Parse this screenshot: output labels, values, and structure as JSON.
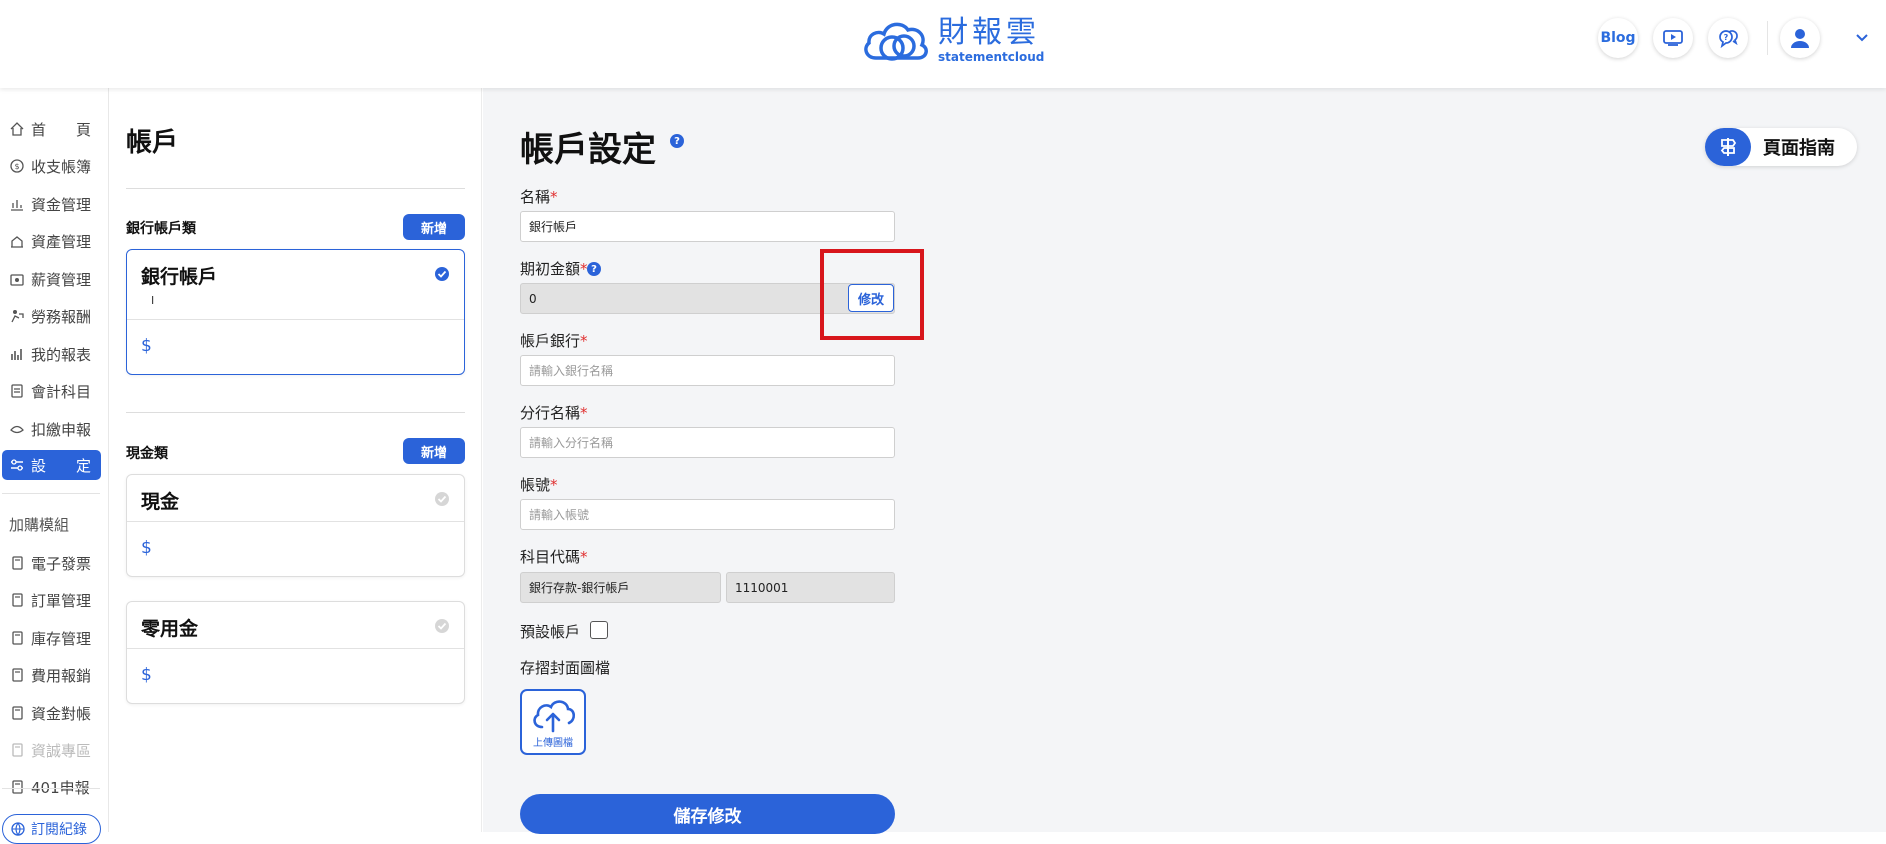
{
  "header": {
    "logo_text": "財報雲",
    "logo_sub": "statementcloud",
    "blog_label": "Blog",
    "icons": [
      "video-guide-icon",
      "support-chat-icon",
      "user-icon",
      "chevron-down-icon"
    ]
  },
  "nav": {
    "items": [
      {
        "label": "首　　頁",
        "icon": "home-icon"
      },
      {
        "label": "收支帳簿",
        "icon": "ledger-icon"
      },
      {
        "label": "資金管理",
        "icon": "fund-icon"
      },
      {
        "label": "資產管理",
        "icon": "asset-icon"
      },
      {
        "label": "薪資管理",
        "icon": "salary-icon"
      },
      {
        "label": "勞務報酬",
        "icon": "service-icon"
      },
      {
        "label": "我的報表",
        "icon": "report-icon"
      },
      {
        "label": "會計科目",
        "icon": "account-icon"
      },
      {
        "label": "扣繳申報",
        "icon": "tax-icon"
      },
      {
        "label": "設　　定",
        "icon": "settings-icon"
      }
    ],
    "addon_heading": "加購模組",
    "addon_items": [
      {
        "label": "電子發票"
      },
      {
        "label": "訂單管理"
      },
      {
        "label": "庫存管理"
      },
      {
        "label": "費用報銷"
      },
      {
        "label": "資金對帳"
      },
      {
        "label": "資誠專區"
      },
      {
        "label": "401申報"
      }
    ],
    "subscription_label": "訂閱紀錄"
  },
  "accounts": {
    "title": "帳戶",
    "bank_category": "銀行帳戶類",
    "cash_category": "現金類",
    "add_label": "新增",
    "bank_cards": [
      {
        "name": "銀行帳戶",
        "sub": "I",
        "amount": "$"
      }
    ],
    "cash_cards": [
      {
        "name": "現金",
        "amount": "$"
      },
      {
        "name": "零用金",
        "amount": "$"
      }
    ]
  },
  "form": {
    "title": "帳戶設定",
    "help": "?",
    "guide_label": "頁面指南",
    "name_label": "名稱",
    "name_value": "銀行帳戶",
    "opening_label": "期初金額",
    "opening_value": "0",
    "edit_label": "修改",
    "bank_label": "帳戶銀行",
    "bank_placeholder": "請輸入銀行名稱",
    "branch_label": "分行名稱",
    "branch_placeholder": "請輸入分行名稱",
    "account_label": "帳號",
    "account_placeholder": "請輸入帳號",
    "code_label": "科目代碼",
    "code_name": "銀行存款-銀行帳戶",
    "code_value": "1110001",
    "default_label": "預設帳戶",
    "default_checked": false,
    "cover_label": "存摺封面圖檔",
    "upload_label": "上傳圖檔",
    "save_label": "儲存修改",
    "required_mark": "*"
  },
  "colors": {
    "accent": "#2b63d9",
    "highlight_box": "#d8161c"
  }
}
